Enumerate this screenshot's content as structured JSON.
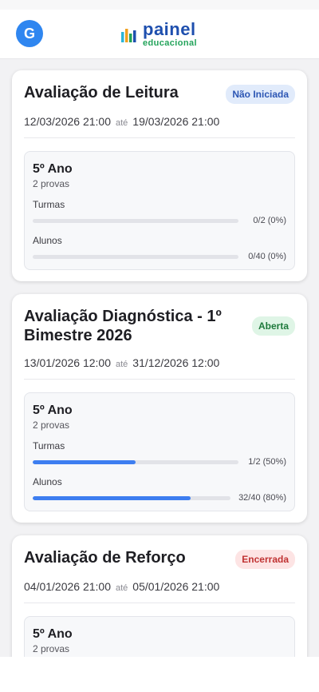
{
  "appbar": {
    "avatar_letter": "G",
    "logo_main": "painel",
    "logo_sub": "educacional"
  },
  "date_separator": "até",
  "cards": [
    {
      "title": "Avaliação de Leitura",
      "status": "Não Iniciada",
      "status_color": "blue",
      "start": "12/03/2026 21:00",
      "end": "19/03/2026 21:00",
      "grade": "5º Ano",
      "provas": "2 provas",
      "metrics": [
        {
          "label": "Turmas",
          "value": "0/2 (0%)",
          "progress": 0
        },
        {
          "label": "Alunos",
          "value": "0/40 (0%)",
          "progress": 0
        }
      ]
    },
    {
      "title": "Avaliação Diagnóstica - 1º Bimestre 2026",
      "status": "Aberta",
      "status_color": "green",
      "start": "13/01/2026 12:00",
      "end": "31/12/2026 12:00",
      "grade": "5º Ano",
      "provas": "2 provas",
      "metrics": [
        {
          "label": "Turmas",
          "value": "1/2 (50%)",
          "progress": 50
        },
        {
          "label": "Alunos",
          "value": "32/40 (80%)",
          "progress": 80
        }
      ]
    },
    {
      "title": "Avaliação de Reforço",
      "status": "Encerrada",
      "status_color": "red",
      "start": "04/01/2026 21:00",
      "end": "05/01/2026 21:00",
      "grade": "5º Ano",
      "provas": "2 provas",
      "metrics": []
    }
  ]
}
